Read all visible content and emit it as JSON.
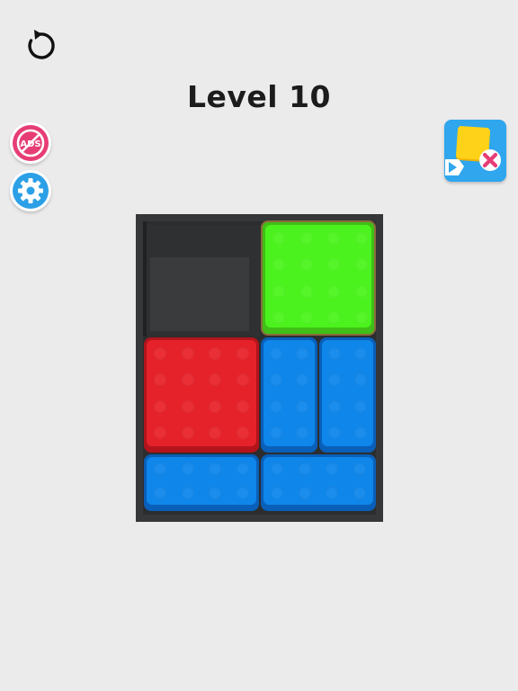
{
  "header": {
    "level_title": "Level 10"
  },
  "buttons": {
    "restart_icon": "restart-icon",
    "no_ads_text": "ADS",
    "no_ads_icon": "no-ads-icon",
    "settings_icon": "gear-icon",
    "skip_level_icon": "skip-level-icon"
  },
  "board": {
    "columns": 4,
    "rows": 5,
    "blocks": [
      {
        "name": "green-block",
        "color": "green",
        "col": 2,
        "row": 0,
        "w": 2,
        "h": 2
      },
      {
        "name": "red-block",
        "color": "red",
        "col": 0,
        "row": 2,
        "w": 2,
        "h": 2
      },
      {
        "name": "blue-block-vertical-left",
        "color": "blue",
        "col": 2,
        "row": 2,
        "w": 1,
        "h": 2
      },
      {
        "name": "blue-block-vertical-right",
        "color": "blue",
        "col": 3,
        "row": 2,
        "w": 1,
        "h": 2
      },
      {
        "name": "blue-block-horizontal-left",
        "color": "blue",
        "col": 0,
        "row": 4,
        "w": 2,
        "h": 1
      },
      {
        "name": "blue-block-horizontal-right",
        "color": "blue",
        "col": 2,
        "row": 4,
        "w": 2,
        "h": 1
      }
    ]
  },
  "colors": {
    "background": "#ebebeb",
    "board": "#363738",
    "green": "#4cf21d",
    "red": "#e5222a",
    "blue": "#0f86ea",
    "ads_button": "#e73d75",
    "settings_button": "#2ca0e6",
    "skip_button": "#2fa6ee"
  }
}
